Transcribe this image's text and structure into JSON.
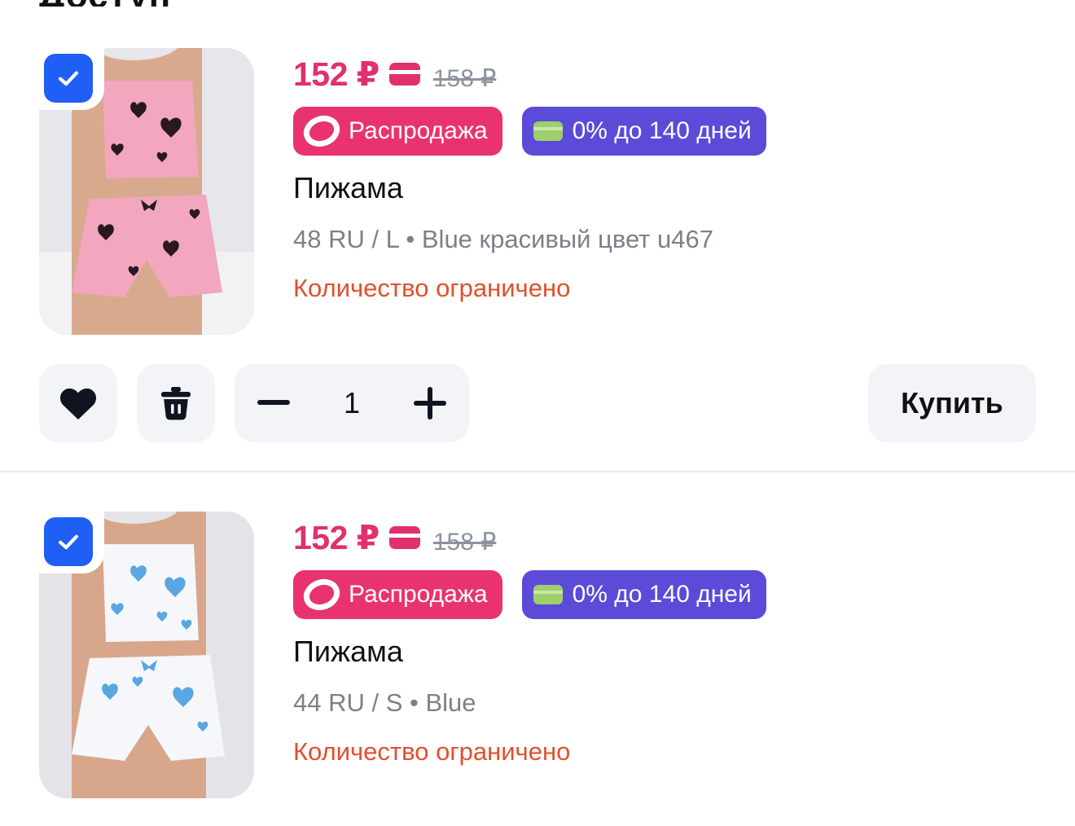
{
  "header": {
    "title_fragment": "Доступ"
  },
  "colors": {
    "price": "#e0306d",
    "sale_badge": "#e8336f",
    "credit_badge": "#5b4bd8",
    "limited": "#e0502c",
    "checkbox": "#1f5ff5"
  },
  "items": [
    {
      "checked": true,
      "price": "152 ₽",
      "old_price": "158 ₽",
      "badges": {
        "sale": "Распродажа",
        "credit": "0% до 140 дней"
      },
      "title": "Пижама",
      "meta": "48 RU / L • Blue красивый цвет u467",
      "stock": "Количество ограничено",
      "quantity": "1",
      "buy_label": "Купить",
      "image_color": "pink"
    },
    {
      "checked": true,
      "price": "152 ₽",
      "old_price": "158 ₽",
      "badges": {
        "sale": "Распродажа",
        "credit": "0% до 140 дней"
      },
      "title": "Пижама",
      "meta": "44 RU / S • Blue",
      "stock": "Количество ограничено",
      "image_color": "white-blue"
    }
  ],
  "icons": {
    "checkbox": "check-icon",
    "card": "card-icon",
    "sale": "sale-ring-icon",
    "credit": "credit-card-icon",
    "favorite": "heart-icon",
    "delete": "trash-icon",
    "minus": "minus-icon",
    "plus": "plus-icon"
  }
}
